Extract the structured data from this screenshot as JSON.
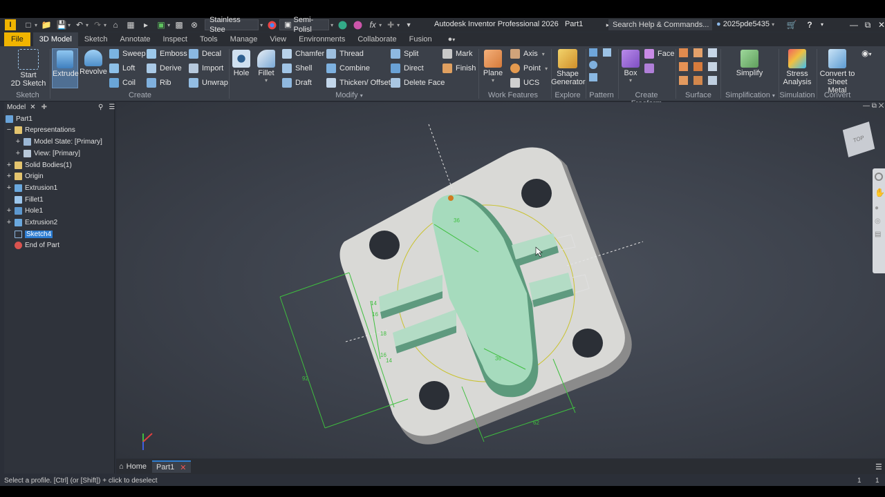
{
  "titlebar": {
    "app_badge": "I",
    "material": "Stainless Stee",
    "appearance": "Semi-Polisl",
    "fx_label": "fx",
    "title": "Autodesk Inventor Professional 2026",
    "document": "Part1",
    "search_placeholder": "Search Help & Commands...",
    "user": "2025pde5435"
  },
  "tabs": [
    "File",
    "3D Model",
    "Sketch",
    "Annotate",
    "Inspect",
    "Tools",
    "Manage",
    "View",
    "Environments",
    "Collaborate",
    "Fusion"
  ],
  "ribbon": {
    "sketch": {
      "start_line1": "Start",
      "start_line2": "2D Sketch",
      "label": "Sketch"
    },
    "create": {
      "extrude": "Extrude",
      "revolve": "Revolve",
      "sweep": "Sweep",
      "loft": "Loft",
      "coil": "Coil",
      "emboss": "Emboss",
      "derive": "Derive",
      "rib": "Rib",
      "decal": "Decal",
      "import": "Import",
      "unwrap": "Unwrap",
      "label": "Create"
    },
    "modify": {
      "hole": "Hole",
      "fillet": "Fillet",
      "chamfer": "Chamfer",
      "shell": "Shell",
      "draft": "Draft",
      "thread": "Thread",
      "combine": "Combine",
      "thicken": "Thicken/ Offset",
      "split": "Split",
      "direct": "Direct",
      "delete_face": "Delete Face",
      "label": "Modify"
    },
    "finish": {
      "mark": "Mark",
      "finish": "Finish"
    },
    "work_features": {
      "plane": "Plane",
      "axis": "Axis",
      "point": "Point",
      "ucs": "UCS",
      "label": "Work Features"
    },
    "explore": {
      "shape_line1": "Shape",
      "shape_line2": "Generator",
      "label": "Explore"
    },
    "pattern": {
      "label": "Pattern"
    },
    "freeform": {
      "box": "Box",
      "face": "Face",
      "label": "Create Freeform"
    },
    "surface": {
      "label": "Surface"
    },
    "simplification": {
      "simplify": "Simplify",
      "label": "Simplification"
    },
    "simulation": {
      "line1": "Stress",
      "line2": "Analysis",
      "label": "Simulation"
    },
    "convert": {
      "line1": "Convert to",
      "line2": "Sheet Metal",
      "label": "Convert"
    }
  },
  "browser": {
    "tab": "Model",
    "items": [
      {
        "label": "Part1"
      },
      {
        "label": "Representations"
      },
      {
        "label": "Model State: [Primary]"
      },
      {
        "label": "View: [Primary]"
      },
      {
        "label": "Solid Bodies(1)"
      },
      {
        "label": "Origin"
      },
      {
        "label": "Extrusion1"
      },
      {
        "label": "Fillet1"
      },
      {
        "label": "Hole1"
      },
      {
        "label": "Extrusion2"
      },
      {
        "label": "Sketch4"
      },
      {
        "label": "End of Part"
      }
    ]
  },
  "viewport": {
    "viewcube": "TOP",
    "dims": {
      "d36a": "36",
      "d36b": "36",
      "d14a": "14",
      "d16a": "16",
      "d18": "18",
      "d16b": "16",
      "d14b": "14",
      "d92": "92",
      "d62": "62"
    }
  },
  "docbar": {
    "home": "Home",
    "part": "Part1"
  },
  "status": {
    "message": "Select a profile. [Ctrl] (or [Shift]) + click to deselect",
    "n1": "1",
    "n2": "1"
  },
  "colors": {
    "accent": "#f0b400",
    "selection": "#2e7dd1",
    "dimension": "#3fbf3f",
    "part_face": "#a8dcc0"
  }
}
